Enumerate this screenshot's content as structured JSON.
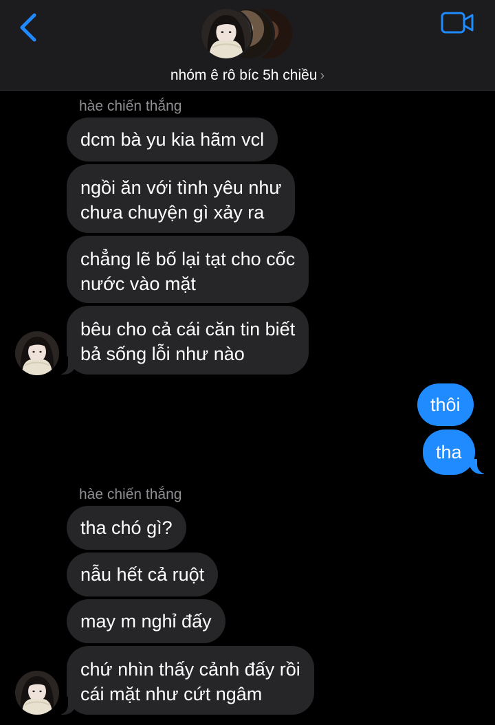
{
  "header": {
    "group_name": "nhóm ê rô bíc 5h chiều",
    "chevron": "›",
    "back_icon": "chevron-left-icon",
    "video_icon": "video-camera-icon",
    "accent": "#1f8bff"
  },
  "messages": {
    "group1": {
      "sender": "hàe chiến thắng",
      "m1": "dcm bà yu kia hãm vcl",
      "m2": "ngồi ăn với tình yêu như\nchưa chuyện gì xảy ra",
      "m3": "chẳng lẽ bố lại tạt cho cốc\nnước vào mặt",
      "m4": "bêu cho cả cái căn tin biết\nbả sống lỗi như nào"
    },
    "mine": {
      "m1": "thôi",
      "m2": "tha"
    },
    "group2": {
      "sender": "hàe chiến thắng",
      "m1": "tha chó gì?",
      "m2": "nẫu hết cả ruột",
      "m3": "may m nghỉ đấy",
      "m4": "chứ nhìn thấy cảnh đấy rồi\ncái mặt như cứt ngâm"
    }
  }
}
